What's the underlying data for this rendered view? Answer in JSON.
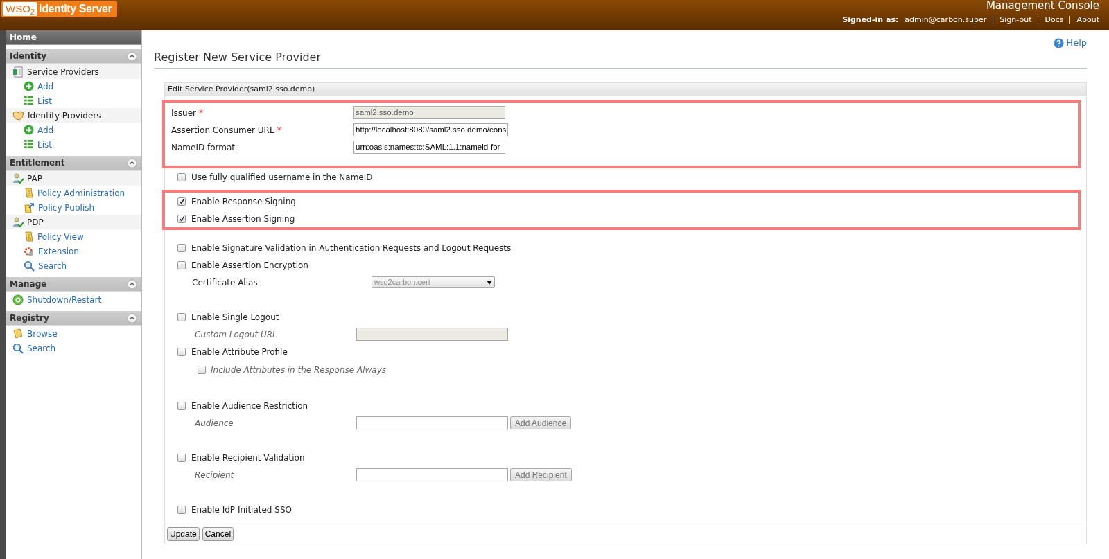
{
  "header": {
    "logo": {
      "mark": "WSO$_{2}$",
      "product": "Identity Server"
    },
    "console_title": "Management Console",
    "signed_in_label": "Signed-in as:",
    "user": "admin@carbon.super",
    "links": [
      "Sign-out",
      "Docs",
      "About"
    ]
  },
  "sidebar": {
    "home": "Home",
    "sections": [
      {
        "title": "Identity",
        "expanded": true,
        "items": [
          {
            "label": "Service Providers",
            "children": [
              {
                "label": "Add"
              },
              {
                "label": "List"
              }
            ]
          },
          {
            "label": "Identity Providers",
            "children": [
              {
                "label": "Add"
              },
              {
                "label": "List"
              }
            ]
          }
        ]
      },
      {
        "title": "Entitlement",
        "expanded": true,
        "items": [
          {
            "label": "PAP",
            "children": [
              {
                "label": "Policy Administration"
              },
              {
                "label": "Policy Publish"
              }
            ]
          },
          {
            "label": "PDP",
            "children": [
              {
                "label": "Policy View"
              },
              {
                "label": "Extension"
              },
              {
                "label": "Search"
              }
            ]
          }
        ]
      },
      {
        "title": "Manage",
        "expanded": true,
        "items": [
          {
            "label": "Shutdown/Restart"
          }
        ]
      },
      {
        "title": "Registry",
        "expanded": true,
        "items": [
          {
            "label": "Browse"
          },
          {
            "label": "Search"
          }
        ]
      }
    ]
  },
  "page": {
    "title": "Register New Service Provider",
    "help": "Help"
  },
  "form": {
    "title": "Edit Service Provider(saml2.sso.demo)",
    "blocks": [
      {
        "highlighted": true,
        "rows": [
          {
            "kind": "field",
            "label": "Issuer",
            "marker": "*",
            "value": "saml2.sso.demo",
            "disabled": true
          },
          {
            "kind": "field",
            "label": "Assertion Consumer URL",
            "marker": "*",
            "value": "http://localhost:8080/saml2.sso.demo/cons",
            "disabled": false
          },
          {
            "kind": "field",
            "label": "NameID format",
            "value": "urn:oasis:names:tc:SAML:1.1:nameid-for",
            "disabled": false
          }
        ]
      },
      {
        "highlighted": false,
        "rows": [
          {
            "kind": "checkbox",
            "label": "Use fully qualified username in the NameID",
            "checked": false
          }
        ]
      },
      {
        "highlighted": true,
        "rows": [
          {
            "kind": "checkbox",
            "label": "Enable Response Signing",
            "checked": true
          },
          {
            "kind": "checkbox",
            "label": "Enable Assertion Signing",
            "checked": true
          }
        ]
      },
      {
        "highlighted": false,
        "rows": [
          {
            "kind": "checkbox",
            "label": "Enable Signature Validation in Authentication Requests and Logout Requests",
            "checked": false
          },
          {
            "kind": "checkbox",
            "label": "Enable Assertion Encryption",
            "checked": false
          },
          {
            "kind": "select",
            "label": "Certificate Alias",
            "value": "wso2carbon.cert",
            "disabled": true
          }
        ]
      },
      {
        "highlighted": false,
        "rows": [
          {
            "kind": "checkbox",
            "label": "Enable Single Logout",
            "checked": false
          },
          {
            "kind": "subfield",
            "label": "Custom Logout URL",
            "disabled": true
          },
          {
            "kind": "checkbox",
            "label": "Enable Attribute Profile",
            "checked": false
          },
          {
            "kind": "subcheckbox",
            "label": "Include Attributes in the Response Always",
            "checked": false
          }
        ]
      },
      {
        "highlighted": false,
        "rows": [
          {
            "kind": "checkbox",
            "label": "Enable Audience Restriction",
            "checked": false
          },
          {
            "kind": "subfield",
            "label": "Audience",
            "disabled": false,
            "button": {
              "label": "Add Audience",
              "disabled": true
            }
          }
        ]
      },
      {
        "highlighted": false,
        "rows": [
          {
            "kind": "checkbox",
            "label": "Enable Recipient Validation",
            "checked": false
          },
          {
            "kind": "subfield",
            "label": "Recipient",
            "disabled": false,
            "button": {
              "label": "Add Recipient",
              "disabled": true
            }
          }
        ]
      },
      {
        "highlighted": false,
        "rows": [
          {
            "kind": "checkbox",
            "label": "Enable IdP Initiated SSO",
            "checked": false
          }
        ]
      }
    ],
    "buttons": [
      "Update",
      "Cancel"
    ]
  }
}
